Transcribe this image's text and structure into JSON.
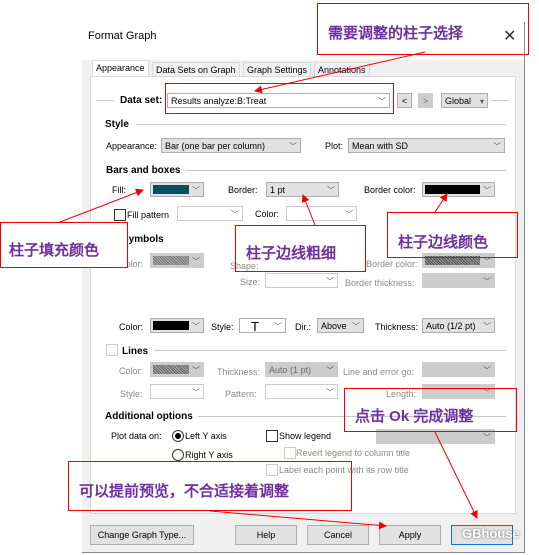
{
  "window": {
    "title": "Format Graph",
    "close_icon": "close-icon"
  },
  "tabs": [
    {
      "label": "Appearance",
      "active": true
    },
    {
      "label": "Data Sets on Graph"
    },
    {
      "label": "Graph Settings"
    },
    {
      "label": "Annotations"
    }
  ],
  "dataset": {
    "label": "Data set:",
    "value": "Results analyze:B:Treat",
    "prev": "<",
    "next": ">",
    "scope": "Global"
  },
  "style": {
    "heading": "Style",
    "appearance_label": "Appearance:",
    "appearance_value": "Bar (one bar per column)",
    "plot_label": "Plot:",
    "plot_value": "Mean with SD"
  },
  "bars": {
    "heading": "Bars and boxes",
    "fill_label": "Fill:",
    "fill_color": "#0b4f5c",
    "border_label": "Border:",
    "border_value": "1 pt",
    "border_color_label": "Border color:",
    "border_color": "#000000",
    "fill_pattern_label": "Fill pattern",
    "color_label": "Color:"
  },
  "symbols": {
    "heading": "Symbols",
    "color_label": "Color:",
    "shape_label": "Shape:",
    "border_color_label": "Border color:",
    "size_label": "Size:",
    "border_thickness_label": "Border thickness:"
  },
  "errorbars": {
    "color_label": "Color:",
    "color": "#000000",
    "style_label": "Style:",
    "style_value": "T",
    "dir_label": "Dir.:",
    "dir_value": "Above",
    "thickness_label": "Thickness:",
    "thickness_value": "Auto (1/2 pt)"
  },
  "lines": {
    "heading": "Lines",
    "color_label": "Color:",
    "thickness_label": "Thickness:",
    "thickness_value": "Auto (1 pt)",
    "line_error_label": "Line and error go:",
    "style_label": "Style:",
    "pattern_label": "Pattern:",
    "length_label": "Length:"
  },
  "additional": {
    "heading": "Additional options",
    "plot_on_label": "Plot data on:",
    "left_axis": "Left Y axis",
    "right_axis": "Right  Y axis",
    "show_legend": "Show legend",
    "revert_legend": "Revert legend to column title",
    "label_each": "Label each point with its row title"
  },
  "buttons": {
    "change_type": "Change Graph Type...",
    "help": "Help",
    "cancel": "Cancel",
    "apply": "Apply",
    "ok": "OK"
  },
  "annotations": {
    "select_bar": "需要调整的柱子选择",
    "fill_color": "柱子填充颜色",
    "border_width": "柱子边线粗细",
    "border_color": "柱子边线颜色",
    "click_ok": "点击 Ok 完成调整",
    "preview": "可以提前预览，不合适接着调整"
  },
  "watermark": "GBhouse",
  "colors": {
    "annotation_border": "#ee0000",
    "annotation_text": "#7030a0"
  }
}
